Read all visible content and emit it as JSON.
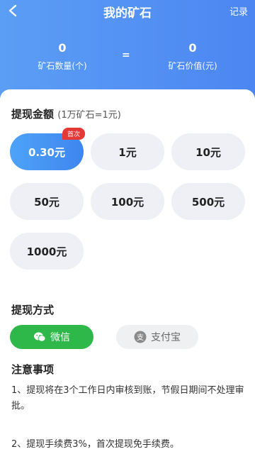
{
  "header": {
    "title": "我的矿石",
    "records_label": "记录",
    "ore_count": "0",
    "ore_count_label": "矿石数量(个)",
    "equals": "=",
    "ore_value": "0",
    "ore_value_label": "矿石价值(元)"
  },
  "withdraw": {
    "title": "提现金额",
    "rate": "(1万矿石=1元)",
    "first_badge": "首次",
    "amounts": [
      "0.30元",
      "1元",
      "10元",
      "50元",
      "100元",
      "500元",
      "1000元"
    ],
    "selected_index": 0
  },
  "method": {
    "title": "提现方式",
    "wechat": "微信",
    "alipay": "支付宝",
    "selected": "wechat"
  },
  "notes": {
    "title": "注意事项",
    "items": [
      "1、提现将在3个工作日内审核到账，节假日期间不处理审批。",
      "2、提现手续费3%，首次提现免手续费。"
    ]
  },
  "colors": {
    "header": "#4c86f2",
    "selected": "#3d86f0",
    "wechat": "#2fb84a",
    "badge": "#e53935"
  }
}
